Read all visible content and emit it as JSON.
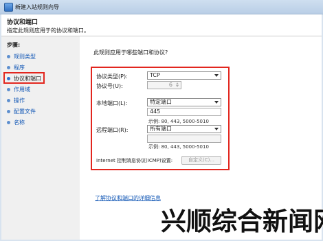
{
  "window": {
    "title": "新建入站规则向导"
  },
  "header": {
    "title": "协议和端口",
    "description": "指定此规则应用于的协议和端口。"
  },
  "steps": {
    "title": "步骤:",
    "items": [
      {
        "label": "规则类型",
        "active": false
      },
      {
        "label": "程序",
        "active": false
      },
      {
        "label": "协议和端口",
        "active": true
      },
      {
        "label": "作用域",
        "active": false
      },
      {
        "label": "操作",
        "active": false
      },
      {
        "label": "配置文件",
        "active": false
      },
      {
        "label": "名称",
        "active": false
      }
    ]
  },
  "form": {
    "question": "此规则应用于哪些端口和协议?",
    "protocol_type_label": "协议类型(P):",
    "protocol_type_value": "TCP",
    "protocol_number_label": "协议号(U):",
    "protocol_number_value": "6",
    "local_port_label": "本地端口(L):",
    "local_port_select": "特定端口",
    "local_port_value": "445",
    "local_example": "示例: 80, 443, 5000-5010",
    "remote_port_label": "远程端口(R):",
    "remote_port_select": "所有端口",
    "remote_port_value": "",
    "remote_example": "示例: 80, 443, 5000-5010",
    "icmp_label": "Internet 控制消息协议(ICMP)设置:",
    "customize_button": "自定义(C)...",
    "learn_more_link": "了解协议和端口的详细信息"
  },
  "watermark": "兴顺综合新闻网",
  "colors": {
    "highlight": "#e2261e",
    "link": "#1358b6"
  }
}
